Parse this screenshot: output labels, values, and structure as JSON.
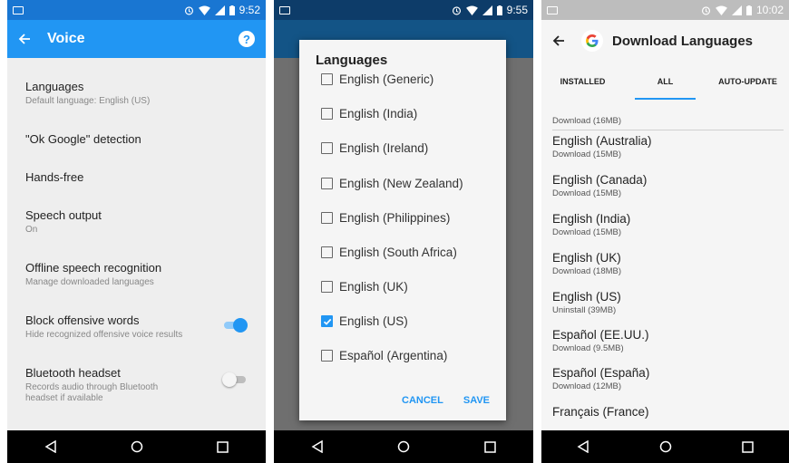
{
  "screens": [
    {
      "status_time": "9:52",
      "app_title": "Voice",
      "settings": [
        {
          "title": "Languages",
          "subtitle": "Default language: English (US)"
        },
        {
          "title": "\"Ok Google\" detection",
          "subtitle": ""
        },
        {
          "title": "Hands-free",
          "subtitle": ""
        },
        {
          "title": "Speech output",
          "subtitle": "On"
        },
        {
          "title": "Offline speech recognition",
          "subtitle": "Manage downloaded languages"
        },
        {
          "title": "Block offensive words",
          "subtitle": "Hide recognized offensive voice results",
          "toggle_on": true
        },
        {
          "title": "Bluetooth headset",
          "subtitle": "Records audio through Bluetooth headset if available",
          "toggle_on": false
        }
      ]
    },
    {
      "status_time": "9:55",
      "dialog": {
        "title": "Languages",
        "options": [
          {
            "label": "English (Generic)",
            "checked": false
          },
          {
            "label": "English (India)",
            "checked": false
          },
          {
            "label": "English (Ireland)",
            "checked": false
          },
          {
            "label": "English (New Zealand)",
            "checked": false
          },
          {
            "label": "English (Philippines)",
            "checked": false
          },
          {
            "label": "English (South Africa)",
            "checked": false
          },
          {
            "label": "English (UK)",
            "checked": false
          },
          {
            "label": "English (US)",
            "checked": true
          },
          {
            "label": "Español (Argentina)",
            "checked": false
          }
        ],
        "cancel_label": "CANCEL",
        "save_label": "SAVE"
      }
    },
    {
      "status_time": "10:02",
      "app_title": "Download Languages",
      "tabs": [
        "INSTALLED",
        "ALL",
        "AUTO-UPDATE"
      ],
      "active_tab": 1,
      "first_subtitle": "Download (16MB)",
      "languages": [
        {
          "name": "English (Australia)",
          "status": "Download (15MB)"
        },
        {
          "name": "English (Canada)",
          "status": "Download (15MB)"
        },
        {
          "name": "English (India)",
          "status": "Download (15MB)"
        },
        {
          "name": "English (UK)",
          "status": "Download (18MB)"
        },
        {
          "name": "English (US)",
          "status": "Uninstall (39MB)"
        },
        {
          "name": "Español (EE.UU.)",
          "status": "Download (9.5MB)"
        },
        {
          "name": "Español (España)",
          "status": "Download (12MB)"
        },
        {
          "name": "Français (France)",
          "status": ""
        }
      ]
    }
  ],
  "colors": {
    "primary": "#2196f3",
    "primary_dark": "#1976d2",
    "nav_bar": "#000000"
  }
}
